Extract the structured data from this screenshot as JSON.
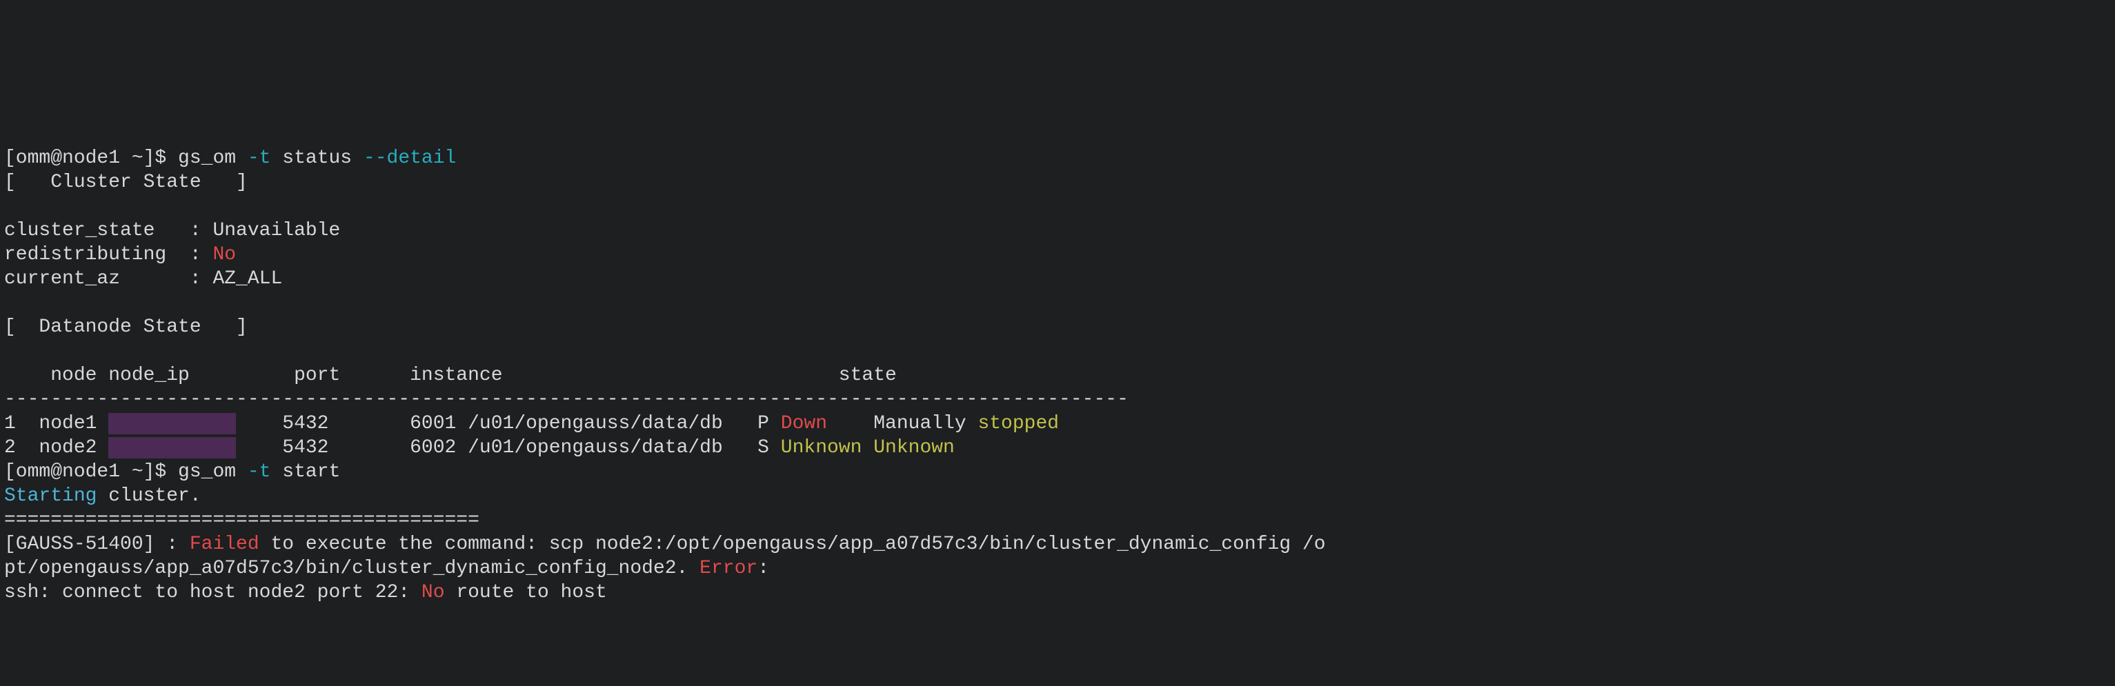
{
  "line1": {
    "prompt": "[omm@node1 ~]$ ",
    "cmd": "gs_om ",
    "flag1": "-t",
    "mid": " status ",
    "flag2": "--detail"
  },
  "line2": "[   Cluster State   ]",
  "blank": "",
  "cs1": {
    "label": "cluster_state   : ",
    "val": "Unavailable"
  },
  "cs2": {
    "label": "redistributing  : ",
    "val": "No"
  },
  "cs3": {
    "label": "current_az      : ",
    "val": "AZ_ALL"
  },
  "ds_header": "[  Datanode State   ]",
  "tbl_head": "    node node_ip         port      instance                             state",
  "dashes": "-------------------------------------------------------------------------------------------------",
  "row1": {
    "a": "1  node1 ",
    "b": "    5432       6001 /u01/opengauss/data/db   P ",
    "down": "Down",
    "c": "    Manually ",
    "stopped": "stopped"
  },
  "row2": {
    "a": "2  node2 ",
    "b": "    5432       6002 /u01/opengauss/data/db   S ",
    "unk1": "Unknown",
    "sp": " ",
    "unk2": "Unknown"
  },
  "line_start": {
    "prompt": "[omm@node1 ~]$ ",
    "cmd": "gs_om ",
    "flag1": "-t",
    "rest": " start"
  },
  "starting": {
    "a": "Starting",
    "b": " cluster."
  },
  "eqline": "=========================================",
  "err1": {
    "a": "[GAUSS-51400] : ",
    "failed": "Failed",
    "b": " to execute the command: scp node2:/opt/opengauss/app_a07d57c3/bin/cluster_dynamic_config /o"
  },
  "err2": {
    "a": "pt/opengauss/app_a07d57c3/bin/cluster_dynamic_config_node2. ",
    "error": "Error",
    "colon": ":"
  },
  "err3": {
    "a": "ssh: connect to host node2 port 22: ",
    "no": "No",
    "b": " route to host"
  }
}
